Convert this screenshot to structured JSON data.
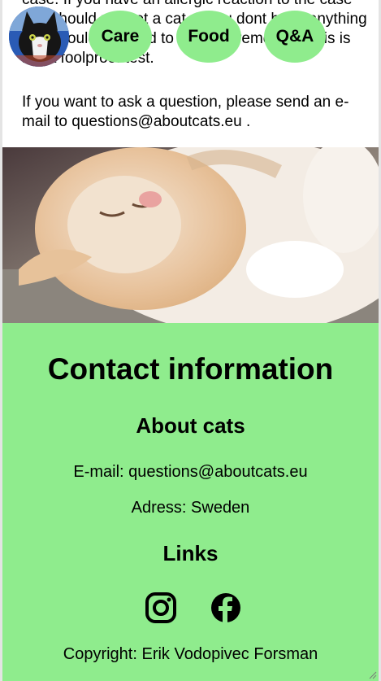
{
  "intro": {
    "paragraph1": "case. If you have an allergic reaction to the case you should not get a cat. If you dont have anything you should be good to go. Just remember this is not a foolproof test.",
    "paragraph2": "If you want to ask a question, please send an e-mail to questions@aboutcats.eu ."
  },
  "nav": {
    "items": [
      {
        "label": "Care"
      },
      {
        "label": "Food"
      },
      {
        "label": "Q&A"
      }
    ]
  },
  "contact": {
    "title": "Contact information",
    "about_heading": "About cats",
    "email_line": "E-mail: questions@aboutcats.eu",
    "adress_line": "Adress: Sweden",
    "links_heading": "Links",
    "social_icons": [
      "instagram-icon",
      "facebook-icon"
    ],
    "copyright": "Copyright: Erik Vodopivec Forsman"
  },
  "colors": {
    "accent_green": "#8fec8d",
    "text": "#000000",
    "background": "#ffffff"
  }
}
